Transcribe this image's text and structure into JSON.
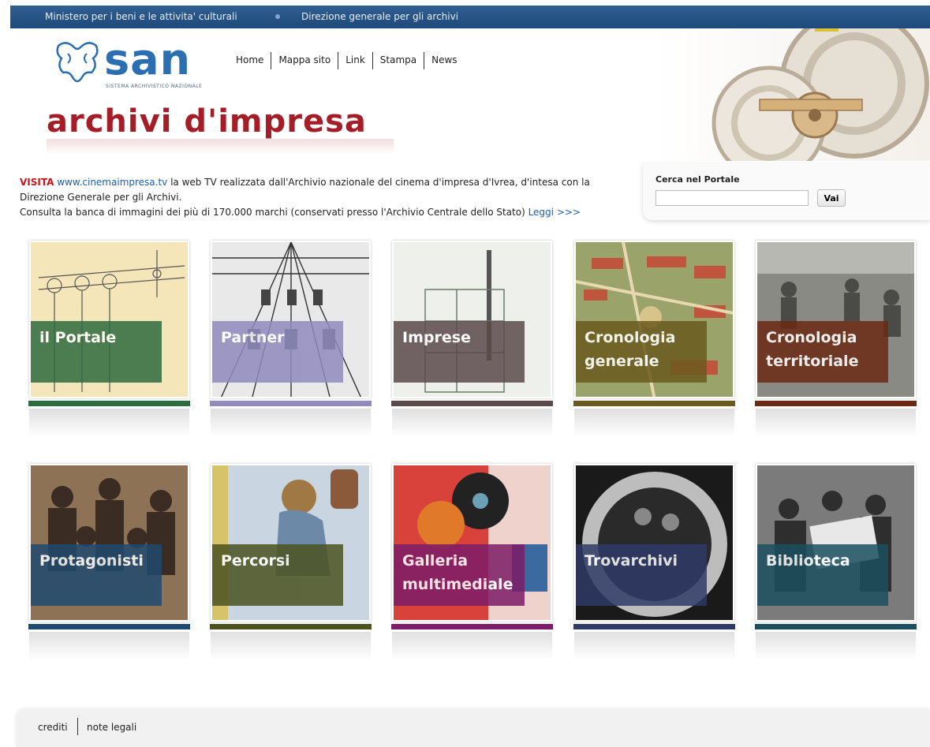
{
  "topbar": {
    "ministry": "Ministero per i beni e le attivita' culturali",
    "direction": "Direzione generale per gli archivi"
  },
  "logo": {
    "name": "san",
    "subtitle": "SISTEMA ARCHIVISTICO NAZIONALE"
  },
  "nav": {
    "items": [
      "Home",
      "Mappa sito",
      "Link",
      "Stampa",
      "News"
    ]
  },
  "brand": {
    "title": "archivi d'impresa"
  },
  "info": {
    "visita": "VISITA",
    "site_link": "www.cinemaimpresa.tv",
    "line1_rest": " la web TV realizzata dall'Archivio nazionale del cinema d'impresa d'Ivrea, d'intesa con la Direzione Generale per gli Archivi.",
    "line2": "Consulta la banca di immagini dei più di 170.000 marchi (conservati presso l'Archivio Centrale dello Stato) ",
    "leggi": "Leggi >>>"
  },
  "search": {
    "label": "Cerca nel Portale",
    "value": "",
    "button": "Vai"
  },
  "tiles": [
    {
      "label": "il Portale",
      "color": "#2e6b3f"
    },
    {
      "label": "Partner",
      "color": "#8f8bbd"
    },
    {
      "label": "Imprese",
      "color": "#5b4a4a"
    },
    {
      "label": "Cronologia generale",
      "color": "#6b5a1e"
    },
    {
      "label": "Cronologia territoriale",
      "color": "#6a2a14"
    },
    {
      "label": "Protagonisti",
      "color": "#1f4a6e"
    },
    {
      "label": "Percorsi",
      "color": "#4b5220"
    },
    {
      "label": "Galleria multimediale",
      "color": "#7d1c67"
    },
    {
      "label": "Trovarchivi",
      "color": "#2f3a66"
    },
    {
      "label": "Biblioteca",
      "color": "#1c5060"
    }
  ],
  "footer": {
    "crediti": "crediti",
    "note": "note legali"
  }
}
